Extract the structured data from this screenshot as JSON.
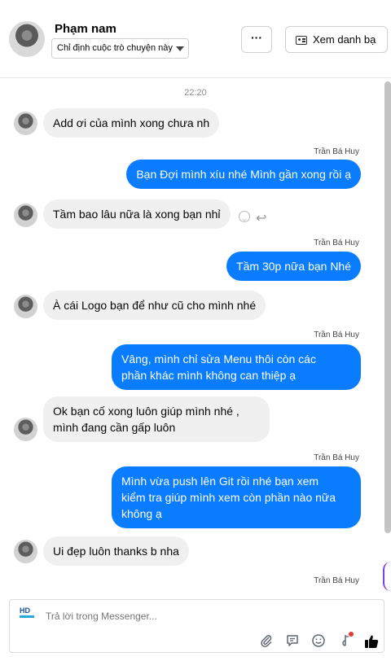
{
  "header": {
    "name": "Phạm nam",
    "assign_label": "Chỉ định cuộc trò chuyện này",
    "more_label": "···",
    "contact_label": "Xem danh bạ"
  },
  "chat": {
    "time": "22:20",
    "messages": [
      {
        "from": "in",
        "text": "Add ơi của mình xong chưa nh"
      },
      {
        "from": "out",
        "sender": "Trần Bá Huy",
        "text": "Bạn Đợi mình xíu nhé Mình gần xong rồi ạ"
      },
      {
        "from": "in",
        "text": "Tầm bao lâu nữa là xong bạn nhỉ"
      },
      {
        "from": "out",
        "sender": "Trần Bá Huy",
        "text": "Tầm 30p nữa bạn Nhé"
      },
      {
        "from": "in",
        "text": "À cái Logo bạn để như cũ cho mình nhé"
      },
      {
        "from": "out",
        "sender": "Trần Bá Huy",
        "lines": [
          "Vâng, mình chỉ sửa Menu thôi còn các",
          "phần khác mình không can thiệp ạ"
        ]
      },
      {
        "from": "in",
        "lines": [
          "Ok bạn cố xong luôn giúp mình nhé ,",
          "mình đang cần gấp luôn"
        ]
      },
      {
        "from": "out",
        "sender": "Trần Bá Huy",
        "lines": [
          "Mình vừa push lên Git rồi nhé bạn xem",
          "kiểm tra giúp mình xem còn phần nào nữa",
          "không ạ"
        ]
      },
      {
        "from": "in",
        "text": "Ui đẹp luôn thanks b nha"
      },
      {
        "from": "out",
        "sender": "Trần Bá Huy"
      }
    ]
  },
  "composer": {
    "logo_text": "HD",
    "placeholder": "Trả lời trong Messenger...",
    "icons": [
      "paperclip-icon",
      "chat-bubble-icon",
      "emoji-icon",
      "d-coin-icon",
      "thumbs-up-icon"
    ]
  },
  "colors": {
    "accent": "#0a7cff",
    "incoming_bubble": "#f0f0f0"
  }
}
